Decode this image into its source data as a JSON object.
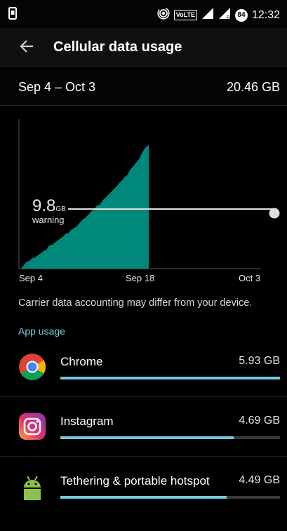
{
  "status_bar": {
    "time": "12:32",
    "volte_label": "VoLTE",
    "battery_level": "84",
    "notification_icon": "phone-screen-icon",
    "hotspot_icon": "hotspot-icon",
    "signal_icon": "signal-icon"
  },
  "header": {
    "title": "Cellular data usage",
    "back_icon": "arrow-left-icon"
  },
  "period": {
    "range": "Sep 4 – Oct 3",
    "total": "20.46 GB"
  },
  "chart": {
    "warning_value": "9.8",
    "warning_unit": "GB",
    "warning_label": "warning",
    "x_ticks": [
      "Sep 4",
      "Sep 18",
      "Oct 3"
    ],
    "fill_color": "#00897b",
    "warning_line_color": "#e0e0e0"
  },
  "chart_data": {
    "type": "area",
    "x": [
      "Sep 4",
      "Sep 18",
      "Oct 3"
    ],
    "warning_gb": 9.8,
    "cumulative_usage_gb": [
      0,
      20.46
    ],
    "series_period_end_fraction": 0.48
  },
  "disclaimer": "Carrier data accounting may differ from your device.",
  "app_usage": {
    "header": "App usage",
    "accent_color": "#79c6dc",
    "apps": [
      {
        "name": "Chrome",
        "size": "5.93 GB",
        "fraction": 1.0,
        "icon": "chrome-icon"
      },
      {
        "name": "Instagram",
        "size": "4.69 GB",
        "fraction": 0.79,
        "icon": "instagram-icon"
      },
      {
        "name": "Tethering & portable hotspot",
        "size": "4.49 GB",
        "fraction": 0.757,
        "icon": "android-icon"
      }
    ]
  }
}
